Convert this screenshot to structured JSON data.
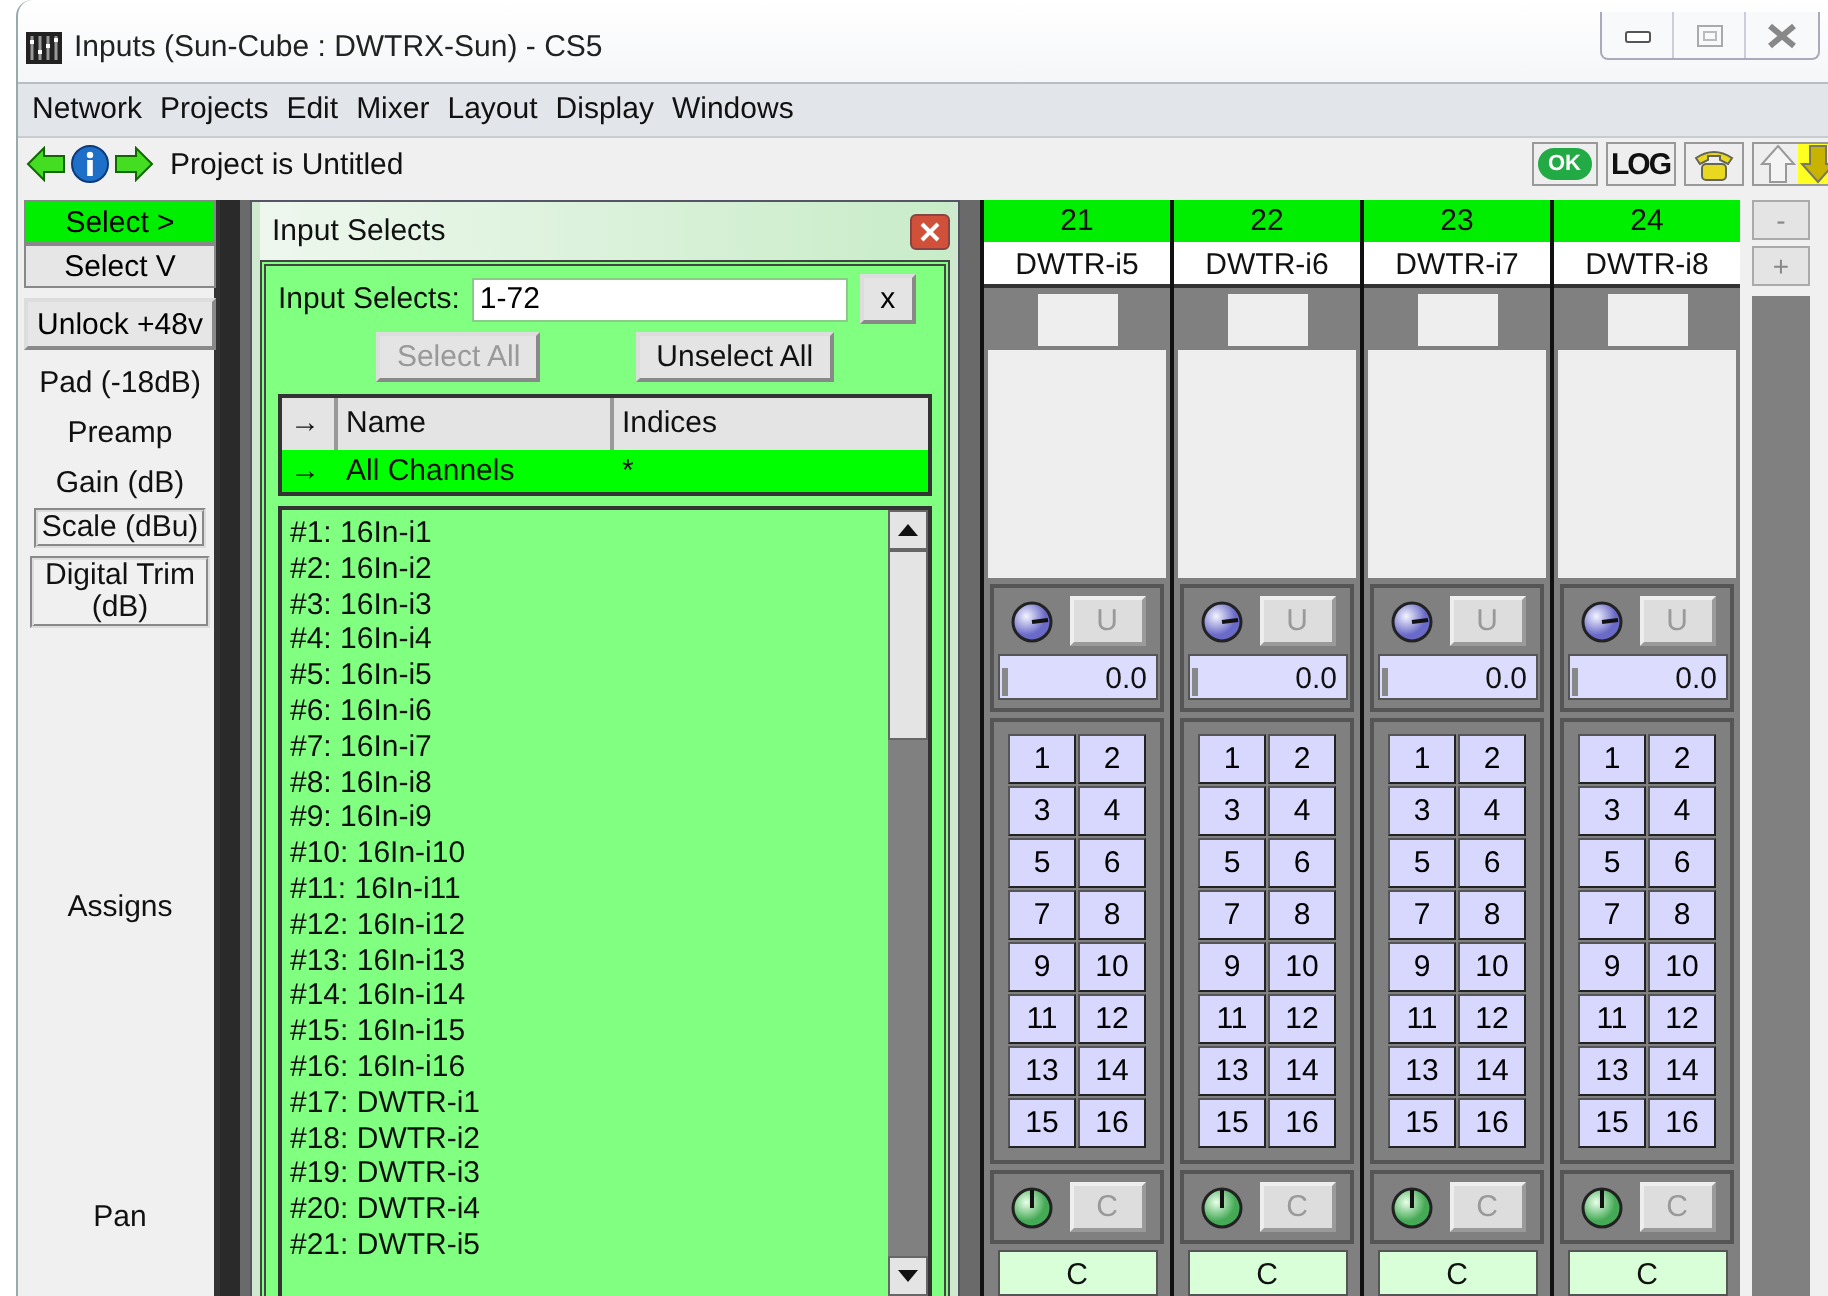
{
  "window": {
    "title": "Inputs (Sun-Cube : DWTRX-Sun) - CS5"
  },
  "menu": [
    "Network",
    "Projects",
    "Edit",
    "Mixer",
    "Layout",
    "Display",
    "Windows"
  ],
  "toolbar": {
    "status": "Project is Untitled",
    "ok_label": "OK",
    "log_label": "LOG"
  },
  "mixer": {
    "select_buttons": [
      {
        "label": "Select >",
        "selected": true
      },
      {
        "label": "Select V",
        "selected": false
      }
    ],
    "unlock_button": "Unlock +48v",
    "row_labels": [
      {
        "label": "Pad (-18dB)",
        "kind": "plain"
      },
      {
        "label": "Preamp",
        "kind": "plain"
      },
      {
        "label": "Gain (dB)",
        "kind": "plain"
      },
      {
        "label": "Scale (dBu)",
        "kind": "boxed"
      },
      {
        "label": "Digital Trim (dB)",
        "kind": "boxed"
      }
    ],
    "assigns_label": "Assigns",
    "pan_label": "Pan",
    "channels": [
      {
        "number": "21",
        "name": "DWTR-i5",
        "gain_button": "U",
        "gain": "0.0",
        "level": 0.05,
        "assigns": [
          "1",
          "2",
          "3",
          "4",
          "5",
          "6",
          "7",
          "8",
          "9",
          "10",
          "11",
          "12",
          "13",
          "14",
          "15",
          "16"
        ],
        "pan_button": "C",
        "pan": "C"
      },
      {
        "number": "22",
        "name": "DWTR-i6",
        "gain_button": "U",
        "gain": "0.0",
        "level": 0.05,
        "assigns": [
          "1",
          "2",
          "3",
          "4",
          "5",
          "6",
          "7",
          "8",
          "9",
          "10",
          "11",
          "12",
          "13",
          "14",
          "15",
          "16"
        ],
        "pan_button": "C",
        "pan": "C"
      },
      {
        "number": "23",
        "name": "DWTR-i7",
        "gain_button": "U",
        "gain": "0.0",
        "level": 0.05,
        "assigns": [
          "1",
          "2",
          "3",
          "4",
          "5",
          "6",
          "7",
          "8",
          "9",
          "10",
          "11",
          "12",
          "13",
          "14",
          "15",
          "16"
        ],
        "pan_button": "C",
        "pan": "C"
      },
      {
        "number": "24",
        "name": "DWTR-i8",
        "gain_button": "U",
        "gain": "0.0",
        "level": 0.05,
        "assigns": [
          "1",
          "2",
          "3",
          "4",
          "5",
          "6",
          "7",
          "8",
          "9",
          "10",
          "11",
          "12",
          "13",
          "14",
          "15",
          "16"
        ],
        "pan_button": "C",
        "pan": "C"
      }
    ],
    "zoom_buttons": [
      "-",
      "+"
    ]
  },
  "dialog": {
    "title": "Input Selects",
    "field_label": "Input Selects:",
    "field_value": "1-72",
    "clear_button": "x",
    "buttons": [
      {
        "label": "Select All",
        "disabled": true
      },
      {
        "label": "Unselect All",
        "disabled": false
      }
    ],
    "table": {
      "columns": [
        "→",
        "Name",
        "Indices"
      ],
      "rows": [
        {
          "marker": "→",
          "name": "All Channels",
          "indices": "*",
          "selected": true
        }
      ]
    },
    "list": [
      "#1: 16In-i1",
      "#2: 16In-i2",
      "#3: 16In-i3",
      "#4: 16In-i4",
      "#5: 16In-i5",
      "#6: 16In-i6",
      "#7: 16In-i7",
      "#8: 16In-i8",
      "#9: 16In-i9",
      "#10: 16In-i10",
      "#11: 16In-i11",
      "#12: 16In-i12",
      "#13: 16In-i13",
      "#14: 16In-i14",
      "#15: 16In-i15",
      "#16: 16In-i16",
      "#17: DWTR-i1",
      "#18: DWTR-i2",
      "#19: DWTR-i3",
      "#20: DWTR-i4",
      "#21: DWTR-i5"
    ]
  }
}
